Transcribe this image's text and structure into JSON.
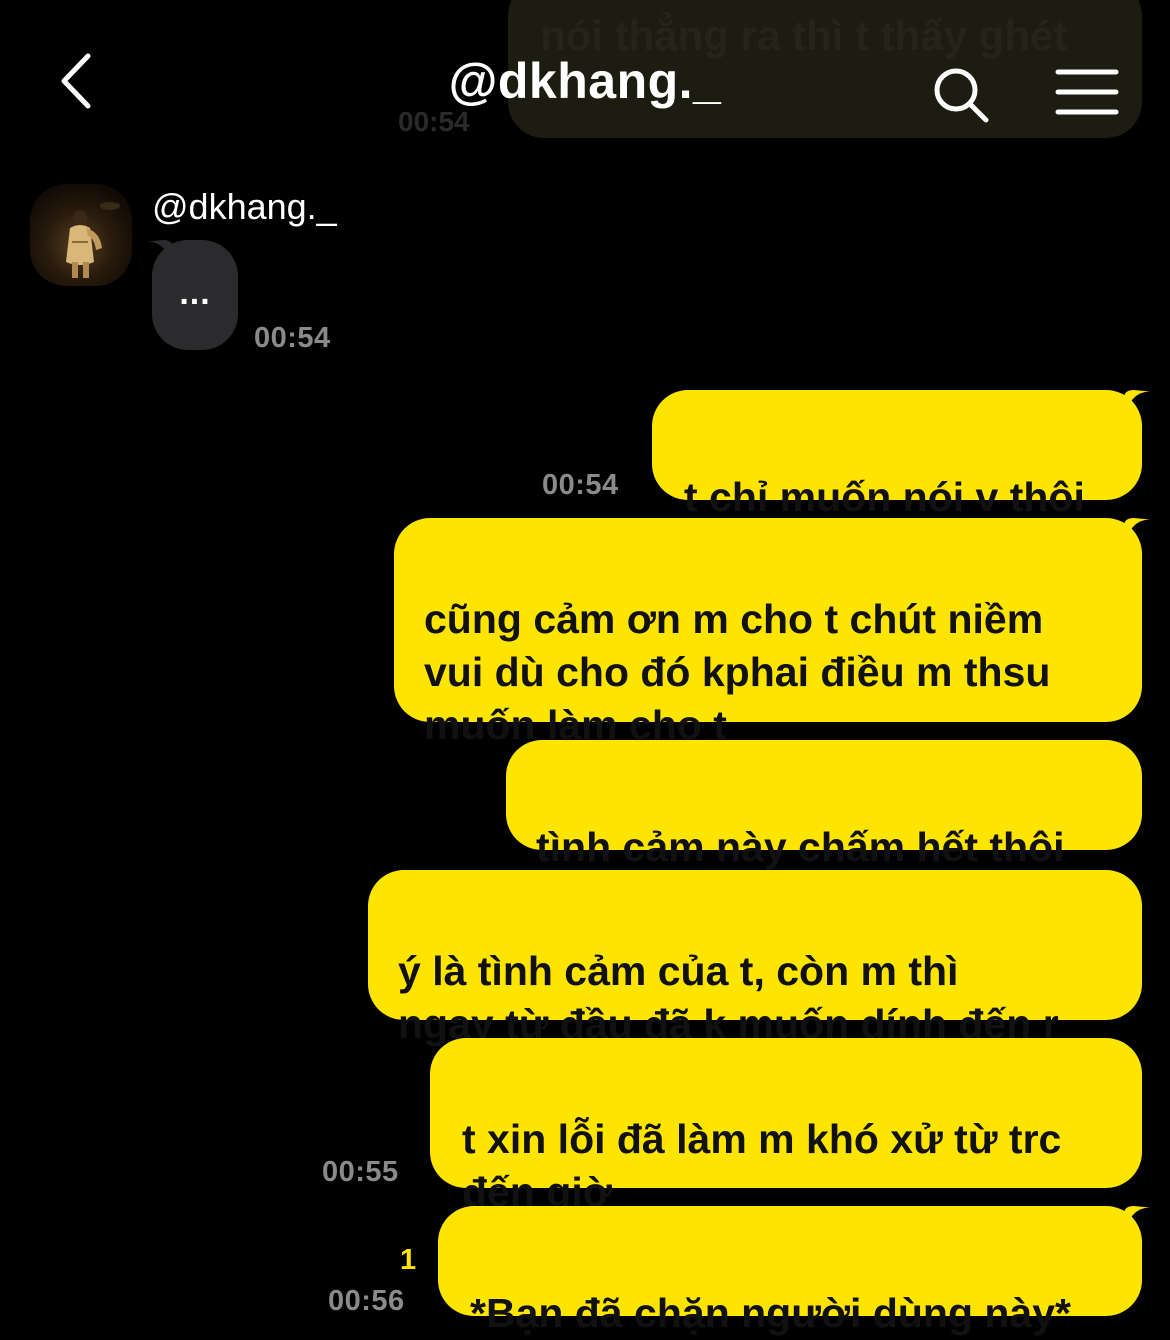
{
  "app": {
    "accent_color": "#fee500",
    "background_color": "#000000"
  },
  "header": {
    "title": "@dkhang._",
    "back_icon": "chevron-left-icon",
    "search_icon": "search-icon",
    "menu_icon": "hamburger-menu-icon"
  },
  "previous_message": {
    "text": "nói thẳng ra thì t thấy ghét",
    "time": "00:54"
  },
  "incoming": {
    "sender": "@dkhang._",
    "typing_indicator": "...",
    "time": "00:54"
  },
  "messages": [
    {
      "text": "t chỉ muốn nói v thôi",
      "time": "00:54"
    },
    {
      "text": "cũng cảm ơn m cho t chút niềm\nvui dù cho đó kphai điều m thsu\nmuốn làm cho t",
      "time": ""
    },
    {
      "text": "tình cảm này chấm hết thôi",
      "time": ""
    },
    {
      "text": "ý là tình cảm của t, còn m thì\nngay từ đầu đã k muốn dính đến r",
      "time": ""
    },
    {
      "text": "t xin lỗi đã làm m khó xử từ trc\nđến giờ",
      "time": "00:55"
    },
    {
      "text": "*Bạn đã chặn người dùng này*",
      "time": "00:56",
      "unread": "1"
    }
  ]
}
